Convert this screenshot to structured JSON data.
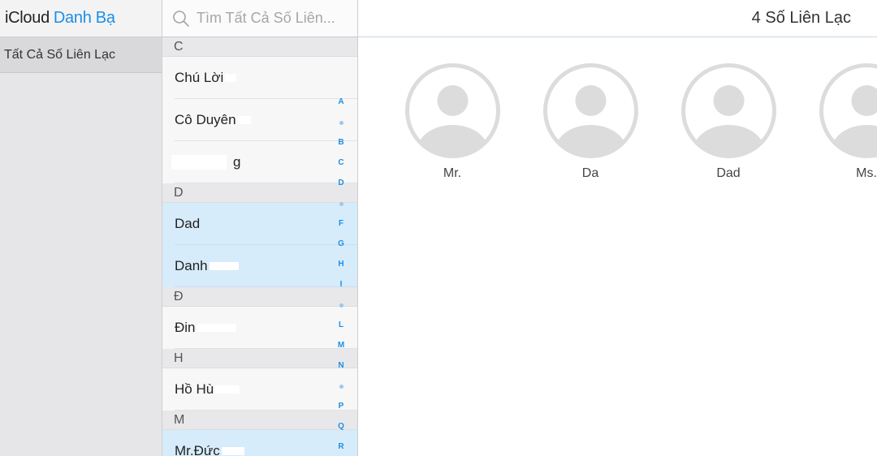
{
  "sidebar": {
    "brand": "iCloud",
    "app_name": "Danh Bạ",
    "groups": [
      {
        "label": "Tất Cả Số Liên Lạc"
      }
    ]
  },
  "list": {
    "search_placeholder": "Tìm Tất Cả Số Liên...",
    "sections": [
      {
        "letter": "C",
        "contacts": [
          "Chú Lời",
          "Cô Duyên",
          "g"
        ]
      },
      {
        "letter": "D",
        "contacts": [
          "Dad",
          "Danh"
        ]
      },
      {
        "letter": "Đ",
        "contacts": [
          "Đin"
        ]
      },
      {
        "letter": "H",
        "contacts": [
          "Hồ Hù"
        ]
      },
      {
        "letter": "M",
        "contacts": [
          "Mr.Đức"
        ]
      }
    ],
    "alpha_index": [
      "A",
      "•",
      "B",
      "C",
      "D",
      "•",
      "F",
      "G",
      "H",
      "I",
      "•",
      "L",
      "M",
      "N",
      "•",
      "P",
      "Q",
      "R"
    ]
  },
  "detail": {
    "count_label": "4 Số Liên Lạc",
    "cards": [
      {
        "name": "Mr."
      },
      {
        "name": "Da"
      },
      {
        "name": "Dad"
      },
      {
        "name": "Ms."
      }
    ]
  },
  "colors": {
    "accent": "#1d8fe6",
    "selected_row": "#d7ecfb",
    "avatar_gray": "#dcdcdc"
  }
}
